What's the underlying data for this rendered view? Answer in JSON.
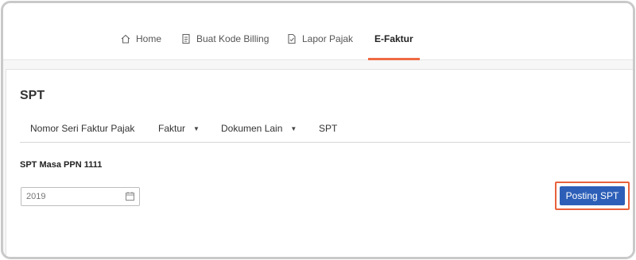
{
  "nav": {
    "items": [
      {
        "label": "Home",
        "icon": "home-icon"
      },
      {
        "label": "Buat Kode Billing",
        "icon": "document-icon"
      },
      {
        "label": "Lapor Pajak",
        "icon": "report-icon"
      },
      {
        "label": "E-Faktur",
        "active": true
      }
    ],
    "active_color": "#ee6a43"
  },
  "page": {
    "title": "SPT"
  },
  "subnav": {
    "items": [
      {
        "label": "Nomor Seri Faktur Pajak"
      },
      {
        "label": "Faktur",
        "dropdown": true
      },
      {
        "label": "Dokumen Lain",
        "dropdown": true
      },
      {
        "label": "SPT"
      }
    ]
  },
  "spt": {
    "section_title": "SPT Masa PPN 1111",
    "year_placeholder": "2019",
    "posting_label": "Posting SPT",
    "posting_color": "#2d5fb8",
    "highlight_color": "#e8613c"
  }
}
